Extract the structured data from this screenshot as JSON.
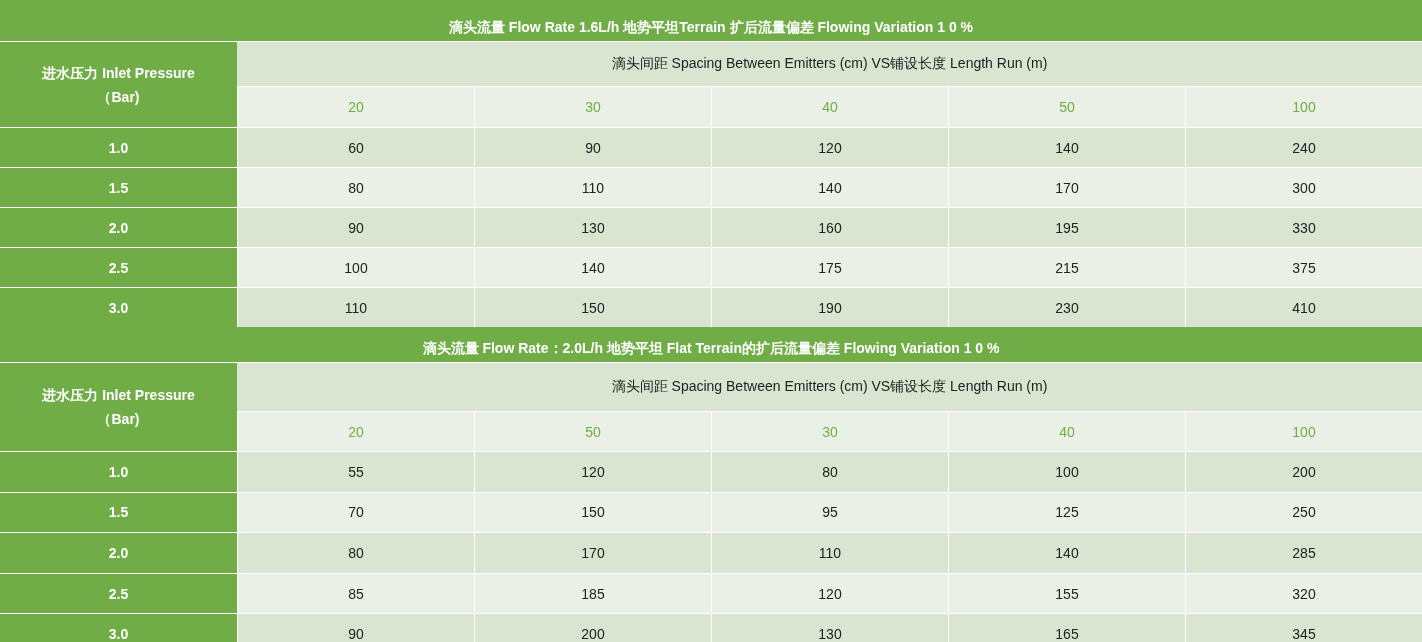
{
  "tables": [
    {
      "title": "滴头流量 Flow Rate 1.6L/h 地势平坦Terrain 扩后流量偏差 Flowing Variation 1 0 %",
      "row_header": "进水压力 Inlet Pressure（Bar)",
      "column_group": "滴头间距 Spacing Between Emitters (cm) VS铺设长度 Length Run (m)",
      "columns": [
        "20",
        "30",
        "40",
        "50",
        "100"
      ],
      "rows": [
        {
          "pressure": "1.0",
          "values": [
            "60",
            "90",
            "120",
            "140",
            "240"
          ]
        },
        {
          "pressure": "1.5",
          "values": [
            "80",
            "110",
            "140",
            "170",
            "300"
          ]
        },
        {
          "pressure": "2.0",
          "values": [
            "90",
            "130",
            "160",
            "195",
            "330"
          ]
        },
        {
          "pressure": "2.5",
          "values": [
            "100",
            "140",
            "175",
            "215",
            "375"
          ]
        },
        {
          "pressure": "3.0",
          "values": [
            "110",
            "150",
            "190",
            "230",
            "410"
          ]
        }
      ]
    },
    {
      "title": "滴头流量 Flow Rate：2.0L/h 地势平坦 Flat Terrain的扩后流量偏差 Flowing Variation 1 0 %",
      "row_header": "进水压力 Inlet Pressure（Bar)",
      "column_group": "滴头间距 Spacing Between Emitters (cm) VS铺设长度 Length Run (m)",
      "columns": [
        "20",
        "50",
        "30",
        "40",
        "100"
      ],
      "rows": [
        {
          "pressure": "1.0",
          "values": [
            "55",
            "120",
            "80",
            "100",
            "200"
          ]
        },
        {
          "pressure": "1.5",
          "values": [
            "70",
            "150",
            "95",
            "125",
            "250"
          ]
        },
        {
          "pressure": "2.0",
          "values": [
            "80",
            "170",
            "110",
            "140",
            "285"
          ]
        },
        {
          "pressure": "2.5",
          "values": [
            "85",
            "185",
            "120",
            "155",
            "320"
          ]
        },
        {
          "pressure": "3.0",
          "values": [
            "90",
            "200",
            "130",
            "165",
            "345"
          ]
        }
      ]
    }
  ]
}
